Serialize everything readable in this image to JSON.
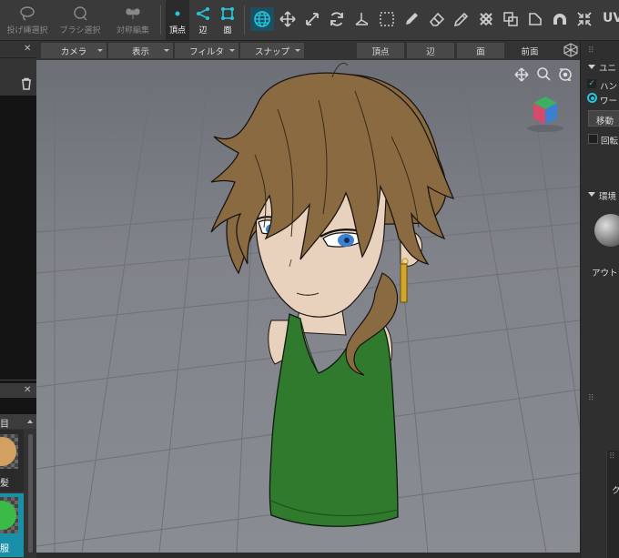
{
  "toolbar": {
    "lasso_select": "投げ縄選択",
    "brush_select": "ブラシ選択",
    "symmetric_edit": "対称編集",
    "vertex": "頂点",
    "edge": "辺",
    "face": "面",
    "uv_label": "UV"
  },
  "menubar": {
    "camera": "カメラ",
    "display": "表示",
    "filter": "フィルタ",
    "snap": "スナップ",
    "vertex": "頂点",
    "edge": "辺",
    "face": "面",
    "front": "前面"
  },
  "left_panel": {
    "item_label": "目",
    "material_1_name": "髪",
    "material_2_name": "服"
  },
  "right_panel": {
    "section_title": "ユニ",
    "option_hand": "ハンド",
    "option_world": "ワー",
    "move_button": "移動",
    "rotate_checkbox": "回転",
    "env_section_title": "環境",
    "outline_label": "アウトライ",
    "bottom_label": "ク"
  },
  "colors": {
    "accent": "#26c6da",
    "hair": "#8a6a40",
    "shirt": "#2f7a2c",
    "skin": "#e8d2bd",
    "eyes": "#3f7fd0",
    "earring": "#d4a628"
  },
  "icons": [
    "lasso-icon",
    "brush-select-icon",
    "butterfly-icon",
    "vertex-icon",
    "edge-icon",
    "face-icon",
    "globe-icon",
    "move-icon",
    "scale-icon",
    "rotate-icon",
    "pivot-icon",
    "marquee-icon",
    "pen-icon",
    "eraser-icon",
    "pencil-icon",
    "sew-icon",
    "overlap-icon",
    "corner-icon",
    "arch-icon",
    "shrink-icon",
    "pan-icon",
    "zoom-icon",
    "orbit-icon",
    "view-cube-icon",
    "trash-icon"
  ]
}
